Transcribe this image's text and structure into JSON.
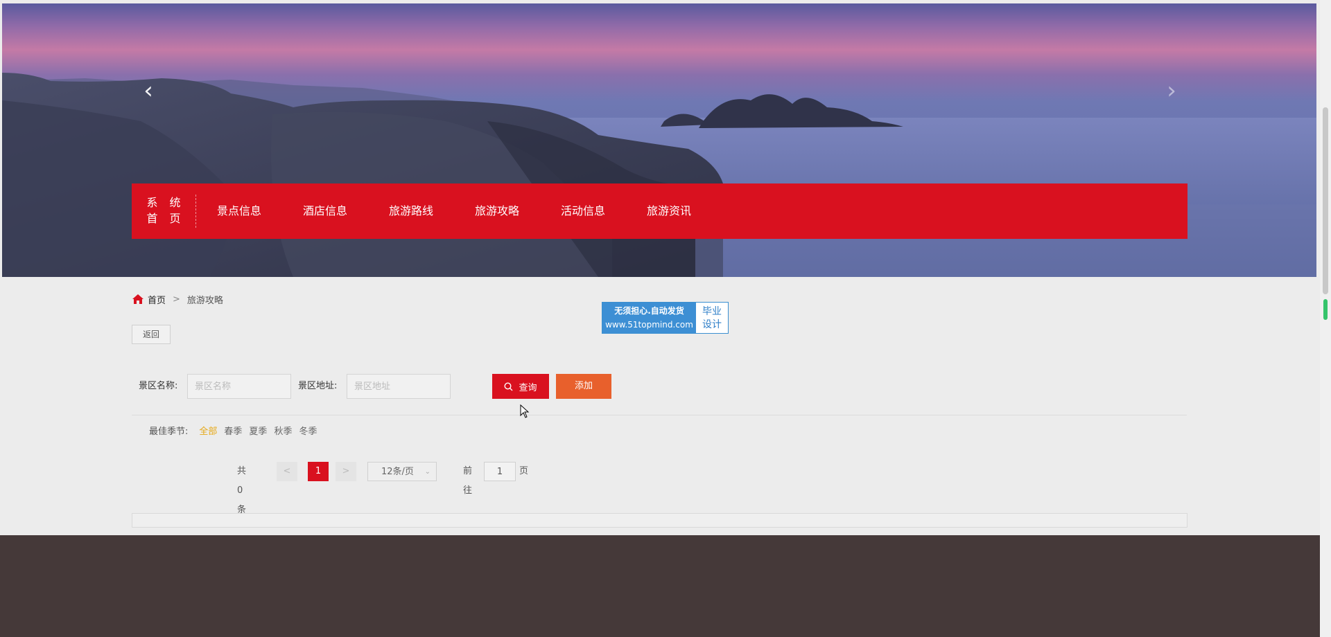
{
  "banner": {
    "prev_arrow": "‹",
    "next_arrow": "›"
  },
  "nav": {
    "home_label_line1": "系 统",
    "home_label_line2": "首 页",
    "items": [
      "景点信息",
      "酒店信息",
      "旅游路线",
      "旅游攻略",
      "活动信息",
      "旅游资讯"
    ],
    "background_color": "#d9111f"
  },
  "breadcrumb": {
    "home": "首页",
    "separator": ">",
    "current": "旅游攻略",
    "icon": "home-icon"
  },
  "ad": {
    "line1": "无须担心.自动发货",
    "line2": "www.51topmind.com",
    "right_line1": "毕业",
    "right_line2": "设计"
  },
  "back_button": "返回",
  "search": {
    "name_label": "景区名称:",
    "name_placeholder": "景区名称",
    "address_label": "景区地址:",
    "address_placeholder": "景区地址",
    "query_button": "查询",
    "add_button": "添加",
    "query_color": "#d9111f",
    "add_color": "#e8602c"
  },
  "season_filter": {
    "label": "最佳季节:",
    "options": [
      "全部",
      "春季",
      "夏季",
      "秋季",
      "冬季"
    ],
    "selected": "全部"
  },
  "pagination": {
    "total": "共 0 条",
    "prev": "<",
    "current_page": "1",
    "next": ">",
    "page_size": "12条/页",
    "goto_label": "前往",
    "goto_value": "1",
    "page_suffix": "页"
  }
}
